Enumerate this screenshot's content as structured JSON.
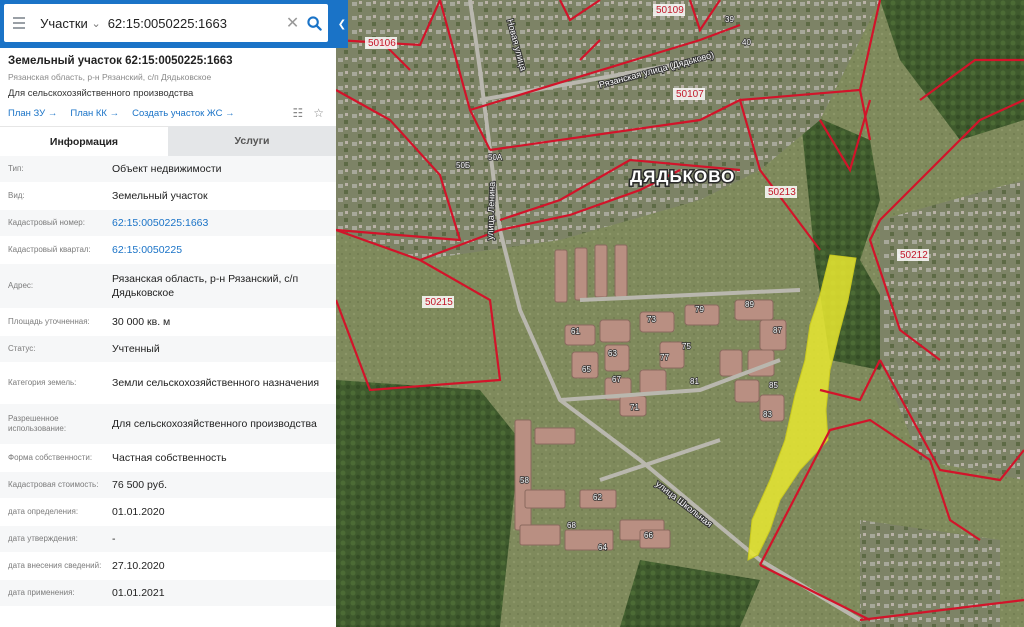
{
  "search": {
    "type_label": "Участки",
    "query": "62:15:0050225:1663"
  },
  "parcel": {
    "title": "Земельный участок 62:15:0050225:1663",
    "address": "Рязанская область, р-н Рязанский, с/п Дядьковское",
    "purpose": "Для сельскохозяйственного производства",
    "links": [
      "План ЗУ →",
      "План КК →",
      "Создать участок ЖС →"
    ]
  },
  "tabs": [
    "Информация",
    "Услуги"
  ],
  "rows": [
    {
      "label": "Тип:",
      "value": "Объект недвижимости"
    },
    {
      "label": "Вид:",
      "value": "Земельный участок"
    },
    {
      "label": "Кадастровый номер:",
      "value": "62:15:0050225:1663",
      "link": true
    },
    {
      "label": "Кадастровый квартал:",
      "value": "62:15:0050225",
      "link": true
    },
    {
      "label": "Адрес:",
      "value": "Рязанская область, р-н Рязанский, с/п Дядьковское"
    },
    {
      "label": "Площадь уточненная:",
      "value": "30 000 кв. м"
    },
    {
      "label": "Статус:",
      "value": "Учтенный"
    },
    {
      "label": "Категория земель:",
      "value": "Земли сельскохозяйственного назначения"
    },
    {
      "label": "Разрешенное использование:",
      "value": "Для сельскохозяйственного производства"
    },
    {
      "label": "Форма собственности:",
      "value": "Частная собственность"
    },
    {
      "label": "Кадастровая стоимость:",
      "value": "76 500 руб."
    },
    {
      "label": "дата определения:",
      "value": "01.01.2020"
    },
    {
      "label": "дата утверждения:",
      "value": "-"
    },
    {
      "label": "дата внесения сведений:",
      "value": "27.10.2020"
    },
    {
      "label": "дата применения:",
      "value": "01.01.2021"
    }
  ],
  "map": {
    "village_name": "ДЯДЬКОВО",
    "quarter_labels": [
      "50109",
      "50106",
      "50107",
      "50213",
      "50212",
      "50215"
    ],
    "street_labels": [
      "улица Ленина",
      "Рязанская улица (Дядьково)",
      "Новая улица",
      "улица Школьная"
    ],
    "house_numbers": [
      "39",
      "40",
      "50А",
      "50Б",
      "61",
      "63",
      "65",
      "67",
      "71",
      "73",
      "75",
      "77",
      "79",
      "81",
      "83",
      "85",
      "87",
      "89",
      "58",
      "62",
      "64",
      "66",
      "68"
    ]
  },
  "colors": {
    "accent": "#1a73c7",
    "boundary": "#d2142a",
    "parcel_fill": "#e8e830"
  }
}
